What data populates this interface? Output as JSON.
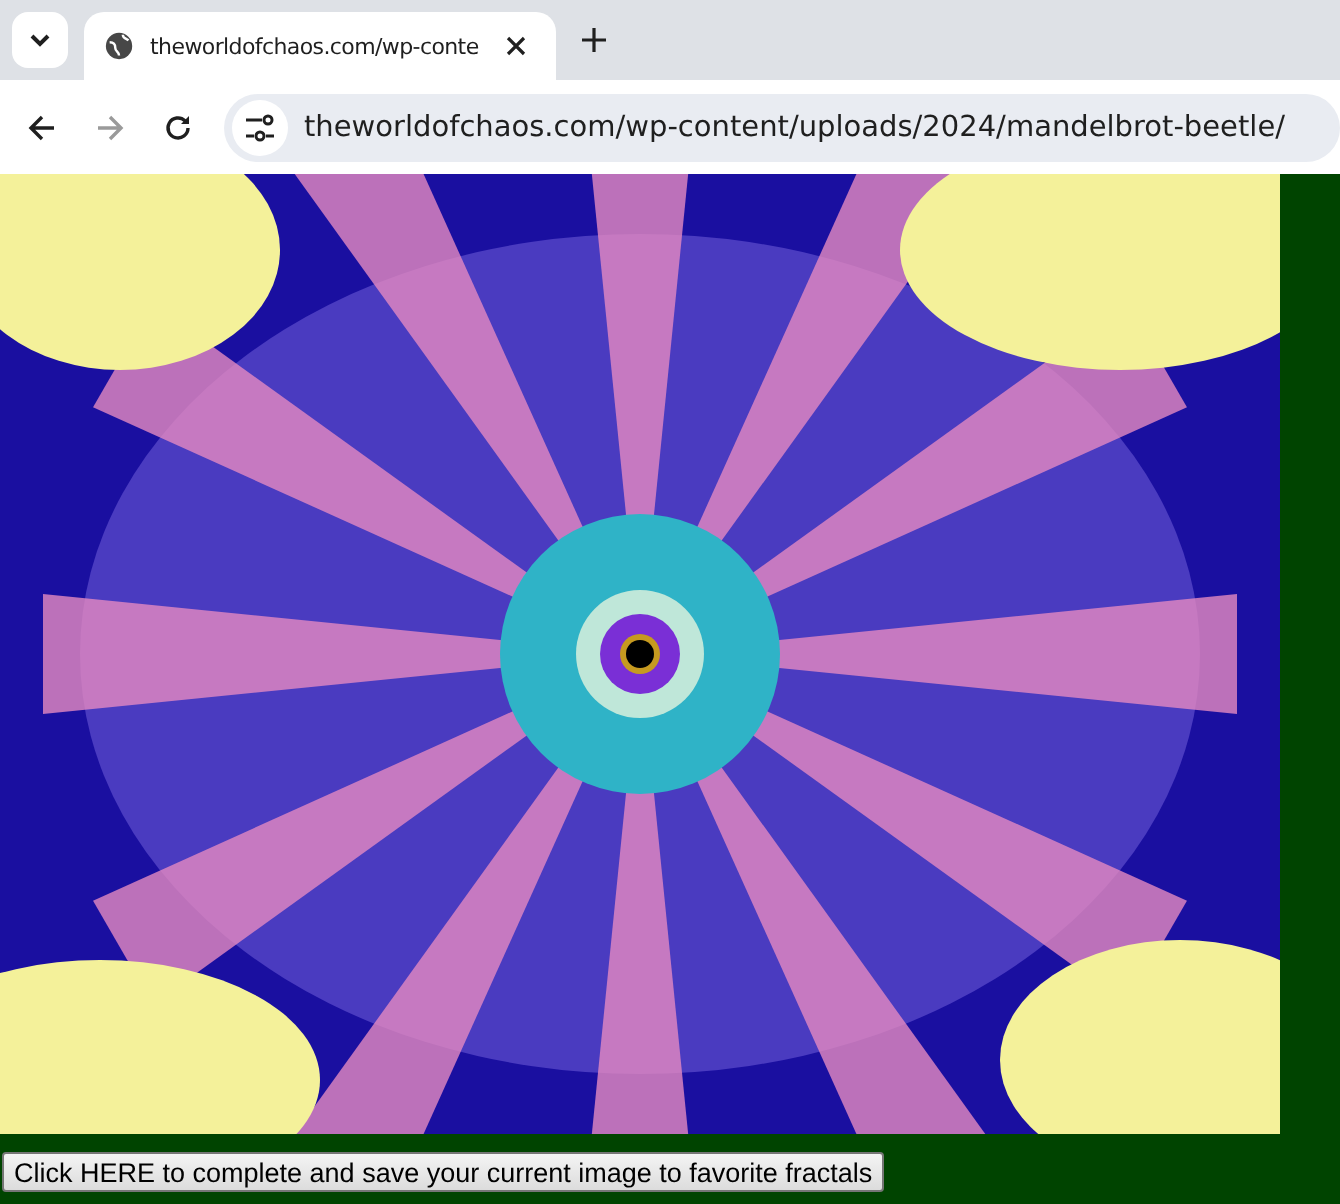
{
  "tab_strip": {
    "tabs": [
      {
        "title": "theworldofchaos.com/wp-conte",
        "selected": true
      }
    ]
  },
  "toolbar": {
    "address": "theworldofchaos.com/wp-content/uploads/2024/mandelbrot-beetle/"
  },
  "page": {
    "save_button": "Click HERE to complete and save your current image to favorite fractals"
  }
}
